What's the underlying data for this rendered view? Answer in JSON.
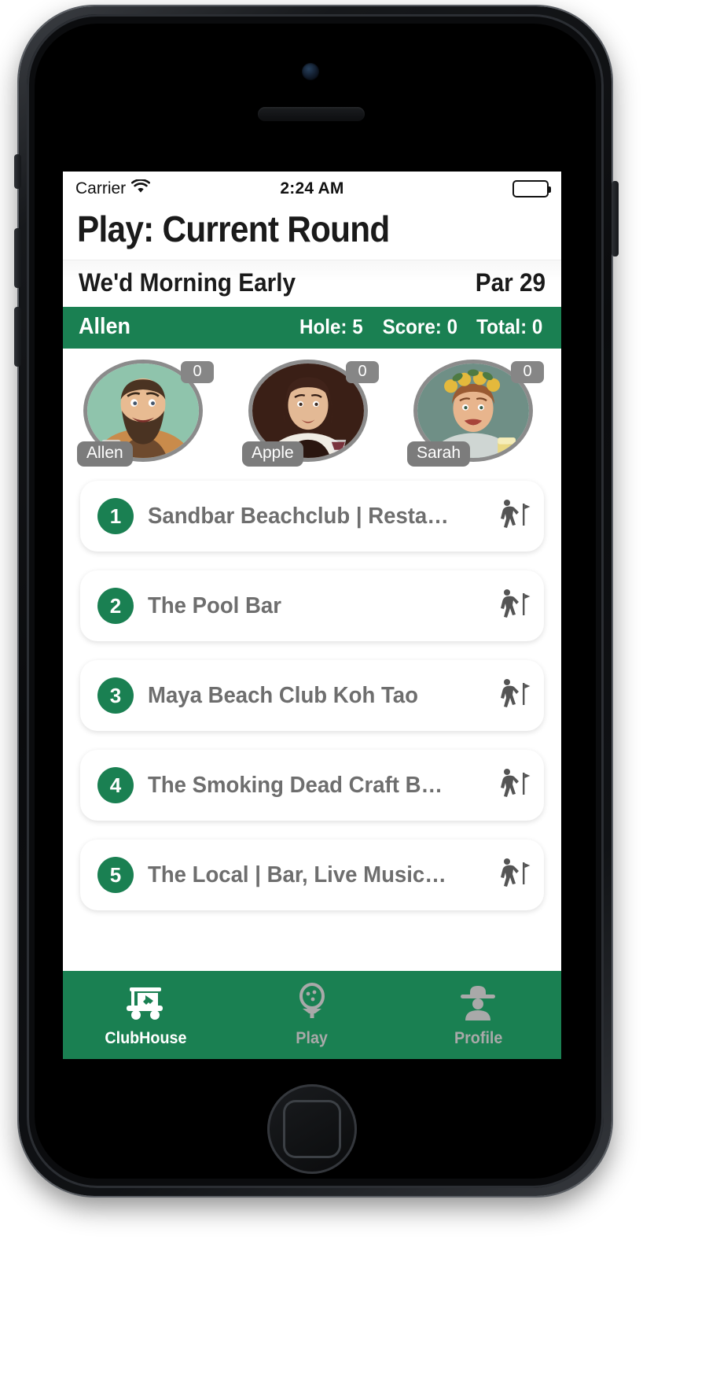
{
  "status_bar": {
    "carrier": "Carrier",
    "wifi_icon": "wifi-icon",
    "time": "2:24 AM",
    "battery_icon": "battery-full-icon"
  },
  "nav": {
    "title": "Play: Current Round"
  },
  "round": {
    "name": "We'd Morning Early",
    "par_label": "Par 29"
  },
  "score_strip": {
    "player": "Allen",
    "hole": "Hole: 5",
    "score": "Score: 0",
    "total": "Total: 0"
  },
  "players": [
    {
      "name": "Allen",
      "score": "0",
      "avatar": "bearded-man-with-beer-avatar"
    },
    {
      "name": "Apple",
      "score": "0",
      "avatar": "woman-with-wine-avatar"
    },
    {
      "name": "Sarah",
      "score": "0",
      "avatar": "woman-with-flower-crown-avatar"
    }
  ],
  "holes": [
    {
      "number": "1",
      "name": "Sandbar Beachclub | Resta…",
      "icon": "golfer-flag-icon"
    },
    {
      "number": "2",
      "name": "The Pool Bar",
      "icon": "golfer-flag-icon"
    },
    {
      "number": "3",
      "name": "Maya Beach Club Koh Tao",
      "icon": "golfer-flag-icon"
    },
    {
      "number": "4",
      "name": "The Smoking Dead Craft B…",
      "icon": "golfer-flag-icon"
    },
    {
      "number": "5",
      "name": "The Local | Bar, Live Music…",
      "icon": "golfer-flag-icon"
    }
  ],
  "tabs": [
    {
      "label": "ClubHouse",
      "icon": "golf-cart-icon",
      "active": true
    },
    {
      "label": "Play",
      "icon": "golf-ball-tee-icon",
      "active": false
    },
    {
      "label": "Profile",
      "icon": "person-hat-icon",
      "active": false
    }
  ],
  "colors": {
    "brand_green": "#1a8052",
    "inactive_tab": "#a9a9a9",
    "hole_text": "#6e6e6e",
    "badge_grey": "#7c7c7c"
  }
}
